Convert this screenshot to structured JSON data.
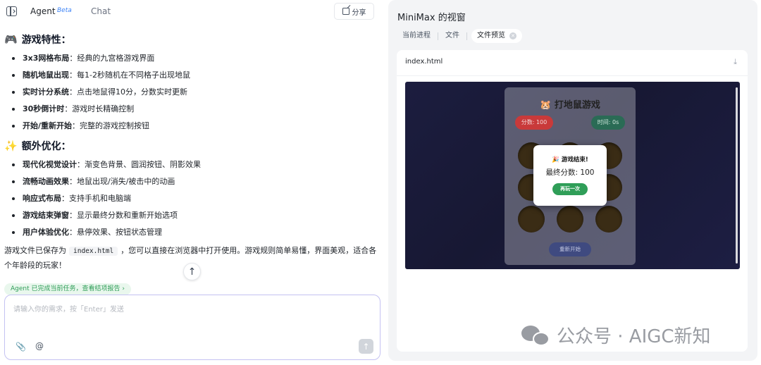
{
  "header": {
    "tab_agent": "Agent",
    "beta_badge": "Beta",
    "tab_chat": "Chat",
    "share_label": "分享"
  },
  "chat": {
    "section1": {
      "icon": "🎮",
      "title": "游戏特性：",
      "items": [
        {
          "bold": "3x3网格布局",
          "text": "：经典的九宫格游戏界面"
        },
        {
          "bold": "随机地鼠出现",
          "text": "：每1-2秒随机在不同格子出现地鼠"
        },
        {
          "bold": "实时计分系统",
          "text": "：点击地鼠得10分，分数实时更新"
        },
        {
          "bold": "30秒倒计时",
          "text": "：游戏时长精确控制"
        },
        {
          "bold": "开始/重新开始",
          "text": "：完整的游戏控制按钮"
        }
      ]
    },
    "section2": {
      "icon": "✨",
      "title": "额外优化：",
      "items": [
        {
          "bold": "现代化视觉设计",
          "text": "：渐变色背景、圆润按钮、阴影效果"
        },
        {
          "bold": "流畅动画效果",
          "text": "：地鼠出现/消失/被击中的动画"
        },
        {
          "bold": "响应式布局",
          "text": "：支持手机和电脑端"
        },
        {
          "bold": "游戏结束弹窗",
          "text": "：显示最终分数和重新开始选项"
        },
        {
          "bold": "用户体验优化",
          "text": "：悬停效果、按钮状态管理"
        }
      ]
    },
    "closing_before": "游戏文件已保存为",
    "closing_code": "index.html",
    "closing_after": "，您可以直接在浏览器中打开使用。游戏规则简单易懂，界面美观，适合各个年龄段的玩家！",
    "done_pill": "Agent 已完成当前任务，查看结项报告 ›"
  },
  "composer": {
    "placeholder": "请输入你的需求，按「Enter」发送",
    "value": ""
  },
  "panel": {
    "title": "MiniMax 的视窗",
    "tabs": [
      "当前进程",
      "文件",
      "文件预览"
    ],
    "active_tab": "文件预览",
    "file_name": "index.html"
  },
  "game": {
    "title_icon": "🐹",
    "title": "打地鼠游戏",
    "score_label": "分数: 100",
    "timer_label": "时间: 0s",
    "restart_label": "重新开始",
    "modal": {
      "title_icon": "🎉",
      "title": "游戏结束!",
      "final_score": "最终分数: 100",
      "again_label": "再玩一次"
    }
  },
  "watermark": {
    "text": "公众号 · AIGC新知"
  },
  "colors": {
    "accent_blue": "#3b82f6",
    "success_green": "#2f9e58",
    "input_border": "#c4c2f2"
  }
}
